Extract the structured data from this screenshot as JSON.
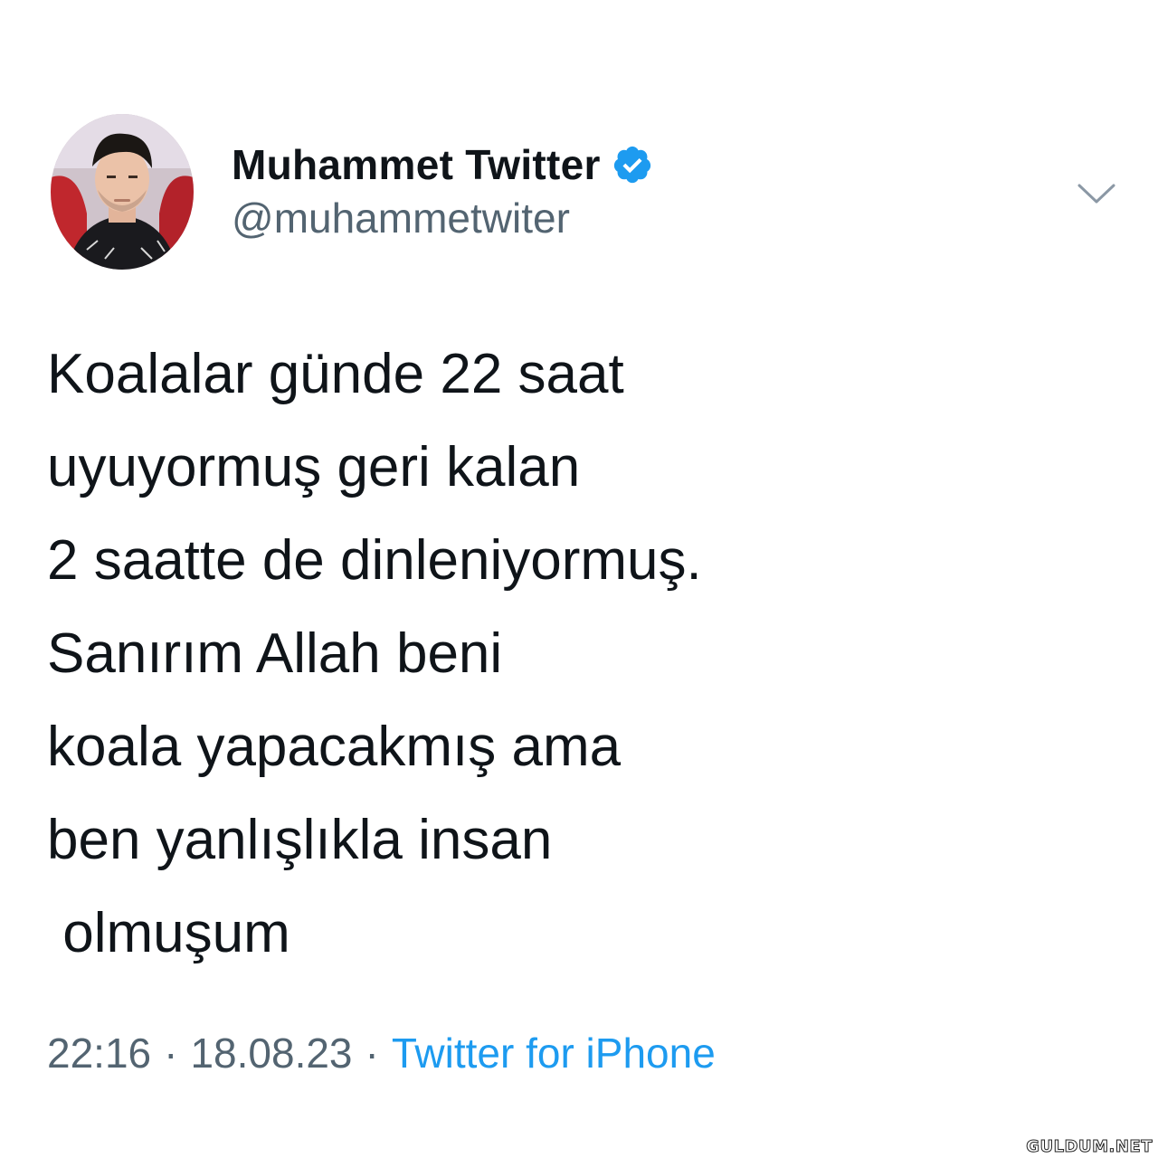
{
  "user": {
    "display_name": "Muhammet Twitter",
    "handle": "@muhammetwiter",
    "verified": true,
    "avatar_icon": "profile-photo"
  },
  "tweet": {
    "lines": [
      "Koalalar günde 22 saat",
      "uyuyormuş geri kalan",
      "2 saatte de dinleniyormuş.",
      "Sanırım Allah beni",
      "koala yapacakmış ama",
      "ben yanlışlıkla insan",
      " olmuşum"
    ]
  },
  "meta": {
    "time": "22:16",
    "separator": "·",
    "date": "18.08.23",
    "source": "Twitter for iPhone"
  },
  "actions": {
    "more_icon": "chevron-down-icon"
  },
  "watermark": {
    "text": "GULDUM.NET"
  },
  "colors": {
    "text": "#0f1419",
    "secondary": "#536471",
    "accent": "#1d9bf0",
    "background": "#ffffff"
  }
}
